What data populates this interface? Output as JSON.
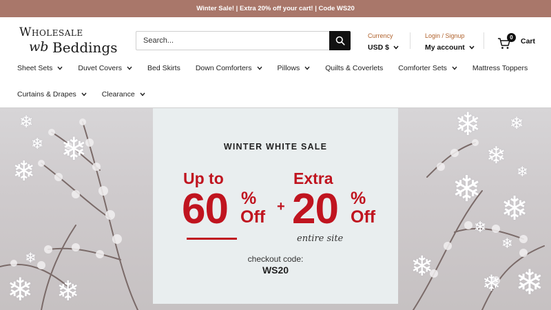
{
  "announcement": "Winter Sale! | Extra 20% off your cart! | Code WS20",
  "logo": {
    "line1": "Wholesale",
    "wb": "wb",
    "line2": "Beddings"
  },
  "search": {
    "placeholder": "Search..."
  },
  "currency": {
    "label": "Currency",
    "value": "USD $"
  },
  "account": {
    "label": "Login / Signup",
    "value": "My account"
  },
  "cart": {
    "count": "0",
    "label": "Cart"
  },
  "nav": {
    "row1": [
      {
        "label": "Sheet Sets",
        "dropdown": true
      },
      {
        "label": "Duvet Covers",
        "dropdown": true
      },
      {
        "label": "Bed Skirts",
        "dropdown": false
      },
      {
        "label": "Down Comforters",
        "dropdown": true
      },
      {
        "label": "Pillows",
        "dropdown": true
      },
      {
        "label": "Quilts & Coverlets",
        "dropdown": false
      },
      {
        "label": "Comforter Sets",
        "dropdown": true
      },
      {
        "label": "Mattress Toppers",
        "dropdown": false
      }
    ],
    "row2": [
      {
        "label": "Curtains & Drapes",
        "dropdown": true
      },
      {
        "label": "Clearance",
        "dropdown": true
      }
    ]
  },
  "hero": {
    "title": "WINTER WHITE SALE",
    "left_heading": "Up to",
    "left_number": "60",
    "left_pct": "%",
    "left_off": "Off",
    "plus": "+",
    "right_heading": "Extra",
    "right_number": "20",
    "right_pct": "%",
    "right_off": "Off",
    "entire": "entire site",
    "code_label": "checkout code:",
    "code": "WS20"
  },
  "colors": {
    "announcement_bg": "#a9776a",
    "accent": "#b0622c",
    "sale_red": "#c0141f"
  }
}
